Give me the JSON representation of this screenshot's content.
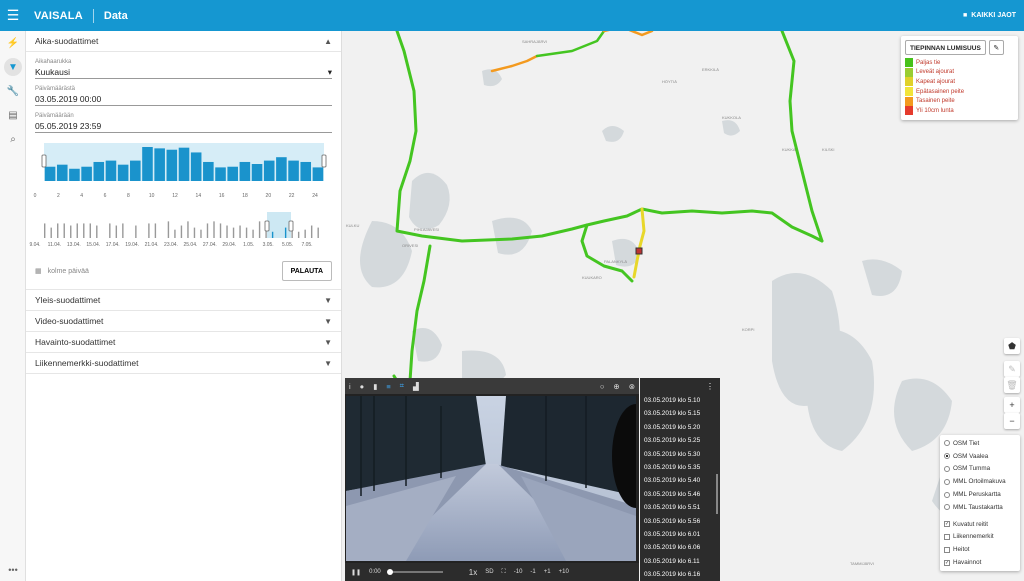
{
  "header": {
    "brand": "VAISALA",
    "title": "Data",
    "right_label": "KAIKKI JAOT"
  },
  "rail": {
    "icons": [
      "bolt-icon",
      "filter-icon",
      "wrench-icon",
      "table-icon",
      "search-icon"
    ],
    "more": "•••"
  },
  "time_filters": {
    "title": "Aika-suodattimet",
    "range_label": "Aikahaarukka",
    "range_value": "Kuukausi",
    "from_label": "Päivämäärästä",
    "from_value": "03.05.2019 00:00",
    "to_label": "Päivämäärään",
    "to_value": "05.05.2019 23:59",
    "hour_ticks": [
      "0",
      "2",
      "4",
      "6",
      "8",
      "10",
      "12",
      "14",
      "16",
      "18",
      "20",
      "22",
      "24"
    ],
    "hour_values": [
      0.42,
      0.48,
      0.36,
      0.42,
      0.56,
      0.6,
      0.48,
      0.6,
      1.0,
      0.96,
      0.92,
      0.98,
      0.84,
      0.56,
      0.4,
      0.42,
      0.56,
      0.5,
      0.6,
      0.7,
      0.6,
      0.56,
      0.4
    ],
    "day_ticks": [
      "9.04.",
      "11.04.",
      "13.04.",
      "15.04.",
      "17.04.",
      "19.04.",
      "21.04.",
      "23.04.",
      "25.04.",
      "27.04.",
      "29.04.",
      "1.05.",
      "3.05.",
      "5.05.",
      "7.05."
    ],
    "day_values": [
      0.7,
      0.5,
      0.7,
      0.7,
      0.6,
      0.7,
      0.7,
      0.7,
      0.6,
      0,
      0.7,
      0.6,
      0.7,
      0,
      0.6,
      0,
      0.7,
      0.7,
      0,
      0.8,
      0.4,
      0.6,
      0.8,
      0.5,
      0.4,
      0.7,
      0.8,
      0.7,
      0.6,
      0.5,
      0.6,
      0.5,
      0.4,
      0.8,
      0.5,
      0.3,
      0,
      0.5,
      0.6,
      0.3,
      0.4,
      0.6,
      0.5
    ],
    "period_label": "kolme päivää",
    "reset_label": "PALAUTA"
  },
  "other_filters": [
    "Yleis-suodattimet",
    "Video-suodattimet",
    "Havainto-suodattimet",
    "Liikennemerkki-suodattimet"
  ],
  "legend": {
    "title": "TIEPINNAN LUMISUUS",
    "items": [
      {
        "label": "Paljas tie",
        "color": "#47c21b"
      },
      {
        "label": "Leveät ajourat",
        "color": "#9acd32"
      },
      {
        "label": "Kapeat ajourat",
        "color": "#e0d12a"
      },
      {
        "label": "Epätasainen peite",
        "color": "#f2e43a"
      },
      {
        "label": "Tasainen peite",
        "color": "#f39a1f"
      },
      {
        "label": "Yli 10cm lunta",
        "color": "#e53b2d"
      }
    ]
  },
  "map_labels": [
    "SAHRAJÄRVI",
    "HÖYTIÄ",
    "KUKKOLA",
    "PIHLAJAVESI",
    "KUKKA",
    "KILSKI",
    "PALANKYLÄ",
    "KUUKARO",
    "TAMMIJÄRVI",
    "KULKU",
    "ORIVESI",
    "ERKKILÄ",
    "KORPI"
  ],
  "layers": {
    "base": [
      {
        "label": "OSM Tiet",
        "selected": false
      },
      {
        "label": "OSM Vaalea",
        "selected": true
      },
      {
        "label": "OSM Tumma",
        "selected": false
      },
      {
        "label": "MML Ortoilmakuva",
        "selected": false
      },
      {
        "label": "MML Peruskartta",
        "selected": false
      },
      {
        "label": "MML Taustakartta",
        "selected": false
      }
    ],
    "overlays": [
      {
        "label": "Kuvatut reitit",
        "checked": true
      },
      {
        "label": "Liikennemerkit",
        "checked": false
      },
      {
        "label": "Heitot",
        "checked": false
      },
      {
        "label": "Havainnot",
        "checked": true
      }
    ]
  },
  "player": {
    "time": "0:00",
    "speed": "1x",
    "quality": "SD",
    "skip": [
      "-10",
      "-1",
      "+1",
      "+10"
    ]
  },
  "timestamps": [
    "03.05.2019 klo 5.10",
    "03.05.2019 klo 5.15",
    "03.05.2019 klo 5.20",
    "03.05.2019 klo 5.25",
    "03.05.2019 klo 5.30",
    "03.05.2019 klo 5.35",
    "03.05.2019 klo 5.40",
    "03.05.2019 klo 5.46",
    "03.05.2019 klo 5.51",
    "03.05.2019 klo 5.56",
    "03.05.2019 klo 6.01",
    "03.05.2019 klo 6.06",
    "03.05.2019 klo 6.11",
    "03.05.2019 klo 6.16"
  ]
}
